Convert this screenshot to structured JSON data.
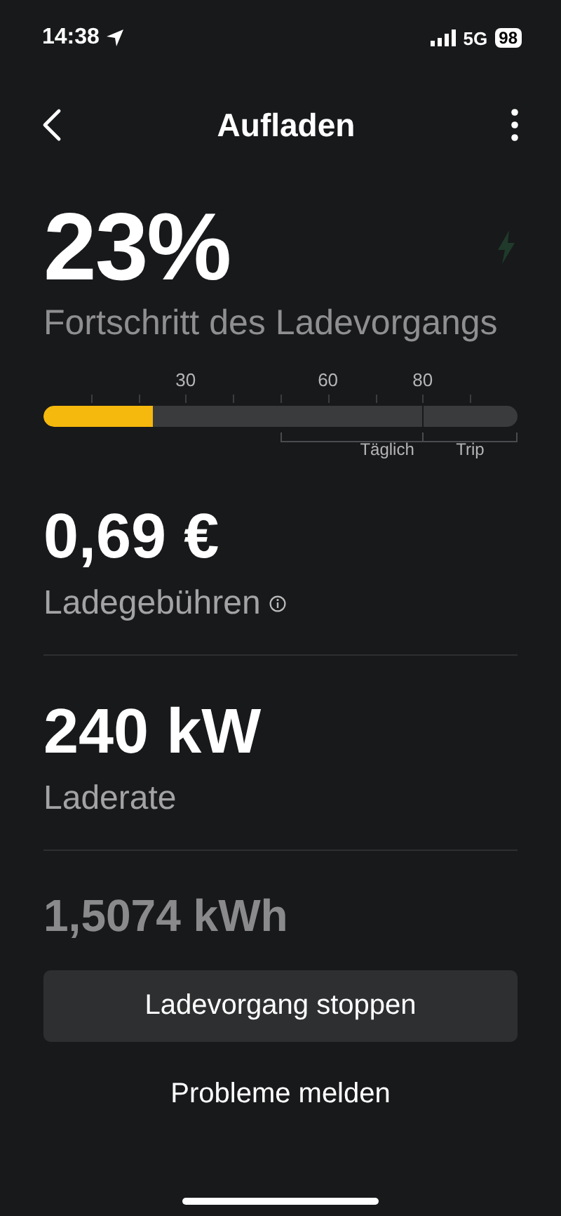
{
  "status_bar": {
    "time": "14:38",
    "network": "5G",
    "battery": "98"
  },
  "header": {
    "title": "Aufladen"
  },
  "charge": {
    "percent": "23%",
    "caption": "Fortschritt des Ladevorgangs",
    "level": 0.23,
    "ticks": [
      {
        "kind": "minor"
      },
      {
        "kind": "minor"
      },
      {
        "kind": "major",
        "label": "30"
      },
      {
        "kind": "minor"
      },
      {
        "kind": "minor"
      },
      {
        "kind": "major",
        "label": "60"
      },
      {
        "kind": "minor"
      },
      {
        "kind": "major",
        "label": "80"
      },
      {
        "kind": "minor"
      }
    ],
    "ranges": [
      {
        "label": "Täglich"
      },
      {
        "label": "Trip"
      }
    ]
  },
  "stats": [
    {
      "value": "0,69 €",
      "label": "Ladegebühren",
      "info": true
    },
    {
      "value": "240 kW",
      "label": "Laderate",
      "info": false
    }
  ],
  "energy": "1,5074 kWh",
  "buttons": [
    {
      "label": "Ladevorgang stoppen",
      "kind": "filled"
    },
    {
      "label": "Probleme melden",
      "kind": "plain"
    }
  ]
}
